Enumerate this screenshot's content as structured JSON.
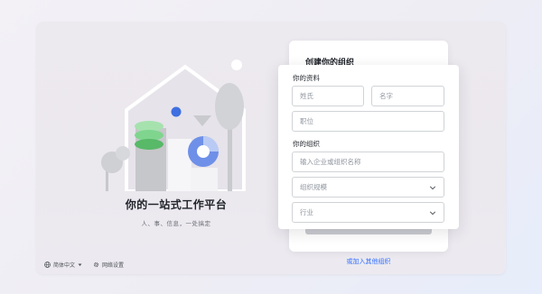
{
  "hero": {
    "tagline": "你的一站式工作平台",
    "subline": "人、事、信息，一处搞定"
  },
  "footer": {
    "language": "简体中文",
    "network_settings": "网络设置"
  },
  "form": {
    "title": "创建你的组织",
    "profile_section": "你的资料",
    "surname_placeholder": "姓氏",
    "given_name_placeholder": "名字",
    "job_title_placeholder": "职位",
    "org_section": "你的组织",
    "org_name_placeholder": "输入企业或组织名称",
    "org_size_placeholder": "组织规模",
    "industry_placeholder": "行业",
    "join_other_link": "或加入其他组织"
  },
  "colors": {
    "accent": "#3370ff",
    "green": "#7fd58e",
    "green_dark": "#58b968",
    "gray": "#c8c9cc"
  }
}
